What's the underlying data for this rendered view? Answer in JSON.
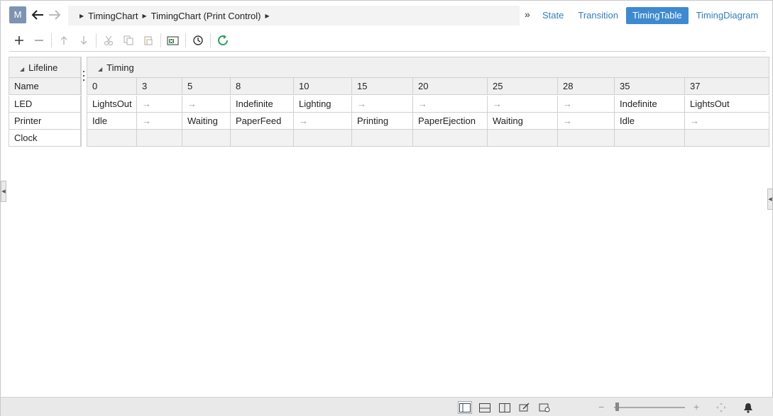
{
  "app": {
    "model_button": "M"
  },
  "breadcrumb": {
    "items": [
      "TimingChart",
      "TimingChart (Print Control)"
    ]
  },
  "more_label": "»",
  "view_tabs": [
    {
      "label": "State",
      "active": false
    },
    {
      "label": "Transition",
      "active": false
    },
    {
      "label": "TimingTable",
      "active": true
    },
    {
      "label": "TimingDiagram",
      "active": false
    }
  ],
  "toolbar": {
    "icons": [
      "add-icon",
      "remove-icon",
      "move-up-icon",
      "move-down-icon",
      "cut-icon",
      "copy-icon",
      "paste-icon",
      "excel-export-icon",
      "history-icon",
      "refresh-icon"
    ]
  },
  "table": {
    "lifeline_group": "Lifeline",
    "timing_group": "Timing",
    "name_header": "Name",
    "times": [
      "0",
      "3",
      "5",
      "8",
      "10",
      "15",
      "20",
      "25",
      "28",
      "35",
      "37"
    ],
    "rows": [
      {
        "name": "LED",
        "cells": [
          "LightsOut",
          "→",
          "→",
          "Indefinite",
          "Lighting",
          "→",
          "→",
          "→",
          "→",
          "Indefinite",
          "LightsOut"
        ]
      },
      {
        "name": "Printer",
        "cells": [
          "Idle",
          "→",
          "Waiting",
          "PaperFeed",
          "→",
          "Printing",
          "PaperEjection",
          "Waiting",
          "→",
          "Idle",
          "→"
        ]
      },
      {
        "name": "Clock",
        "cells": [
          "",
          "",
          "",
          "",
          "",
          "",
          "",
          "",
          "",
          "",
          ""
        ]
      }
    ]
  },
  "statusbar": {
    "zoom_minus": "−",
    "zoom_plus": "+"
  },
  "colors": {
    "accent": "#3d8ad1",
    "tab_text": "#2f7fc1",
    "refresh": "#2aa05a"
  }
}
